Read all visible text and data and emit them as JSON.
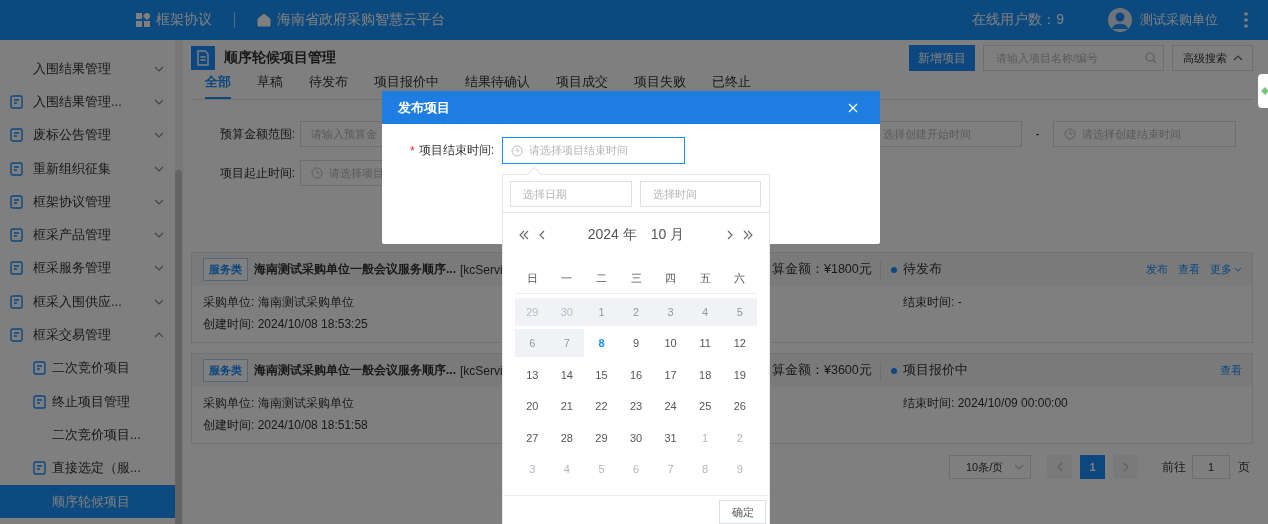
{
  "header": {
    "app_name": "框架协议",
    "platform": "海南省政府采购智慧云平台",
    "online_users": "在线用户数：9",
    "user": "测试采购单位"
  },
  "sidebar": {
    "items": [
      {
        "label": "入围结果管理",
        "kind": "plain",
        "expanded": false,
        "selected": false
      },
      {
        "label": "入围结果管理...",
        "kind": "iconed",
        "expanded": false,
        "selected": false
      },
      {
        "label": "废标公告管理",
        "kind": "iconed",
        "expanded": false,
        "selected": false
      },
      {
        "label": "重新组织征集",
        "kind": "iconed",
        "expanded": false,
        "selected": false
      },
      {
        "label": "框架协议管理",
        "kind": "iconed",
        "expanded": false,
        "selected": false
      },
      {
        "label": "框采产品管理",
        "kind": "iconed",
        "expanded": false,
        "selected": false
      },
      {
        "label": "框采服务管理",
        "kind": "iconed",
        "expanded": false,
        "selected": false
      },
      {
        "label": "框采入围供应...",
        "kind": "iconed",
        "expanded": false,
        "selected": false
      },
      {
        "label": "框采交易管理",
        "kind": "iconed",
        "expanded": true,
        "selected": false,
        "children": [
          {
            "label": "二次竞价项目",
            "kind": "iconed",
            "selected": false
          },
          {
            "label": "终止项目管理",
            "kind": "iconed",
            "selected": false
          },
          {
            "label": "二次竞价项目...",
            "kind": "plain",
            "selected": false
          },
          {
            "label": "直接选定（服...",
            "kind": "iconed",
            "selected": false
          },
          {
            "label": "顺序轮候项目",
            "kind": "plain",
            "selected": true
          }
        ]
      }
    ]
  },
  "page": {
    "title": "顺序轮候项目管理",
    "add_button": "新增项目",
    "search": {
      "placeholder": "请输入项目名称/编号"
    },
    "advanced_search": {
      "label": "高级搜索",
      "expanded": true
    }
  },
  "tabs": [
    {
      "label": "全部",
      "selected": true
    },
    {
      "label": "草稿",
      "selected": false
    },
    {
      "label": "待发布",
      "selected": false
    },
    {
      "label": "项目报价中",
      "selected": false
    },
    {
      "label": "结果待确认",
      "selected": false
    },
    {
      "label": "项目成交",
      "selected": false
    },
    {
      "label": "项目失败",
      "selected": false
    },
    {
      "label": "已终止",
      "selected": false
    }
  ],
  "filters": {
    "budget_label": "预算金额范围:",
    "budget_placeholder": "请输入预算金",
    "period_label": "项目起止时间:",
    "period_placeholder": "请选择项目",
    "created_start_placeholder": "选择创建开始时间",
    "separator": "-",
    "created_end_placeholder": "请选择创建结束时间"
  },
  "cards": [
    {
      "tag": "服务类",
      "title": "海南测试采购单位一般会议服务顺序...",
      "code": "[kcServi",
      "budget": "算金额：¥1800元",
      "status": "待发布",
      "actions": [
        {
          "label": "发布",
          "kind": "link"
        },
        {
          "label": "查看",
          "kind": "link"
        },
        {
          "label": "更多",
          "kind": "dropdown"
        }
      ],
      "buyer": "采购单位: 海南测试采购单位",
      "created": "创建时间: 2024/10/08 18:53:25",
      "end": "结束时间: -"
    },
    {
      "tag": "服务类",
      "title": "海南测试采购单位一般会议服务顺序...",
      "code": "[kcServi",
      "budget": "算金额：¥3600元",
      "status": "项目报价中",
      "actions": [
        {
          "label": "查看",
          "kind": "link"
        }
      ],
      "buyer": "采购单位: 海南测试采购单位",
      "created": "创建时间: 2024/10/08 18:51:58",
      "end": "结束时间: 2024/10/09 00:00:00"
    }
  ],
  "pagination": {
    "page_size": "10条/页",
    "pages": [
      {
        "label": "1",
        "selected": true
      }
    ],
    "goto_label": "前往",
    "goto_value": "1",
    "page_suffix": "页"
  },
  "dialog": {
    "title": "发布项目",
    "field_label": "项目结束时间:",
    "required_mark": "*",
    "placeholder": "请选择项目结束时间"
  },
  "date_picker": {
    "date_placeholder": "选择日期",
    "time_placeholder": "选择时间",
    "year": "2024 年",
    "month": "10 月",
    "weekdays": [
      "日",
      "一",
      "二",
      "三",
      "四",
      "五",
      "六"
    ],
    "weeks": [
      [
        {
          "day": "29",
          "outside": true,
          "disabled": true,
          "today": false
        },
        {
          "day": "30",
          "outside": true,
          "disabled": true,
          "today": false
        },
        {
          "day": "1",
          "outside": false,
          "disabled": true,
          "today": false
        },
        {
          "day": "2",
          "outside": false,
          "disabled": true,
          "today": false
        },
        {
          "day": "3",
          "outside": false,
          "disabled": true,
          "today": false
        },
        {
          "day": "4",
          "outside": false,
          "disabled": true,
          "today": false
        },
        {
          "day": "5",
          "outside": false,
          "disabled": true,
          "today": false
        }
      ],
      [
        {
          "day": "6",
          "outside": false,
          "disabled": true,
          "today": false
        },
        {
          "day": "7",
          "outside": false,
          "disabled": true,
          "today": false
        },
        {
          "day": "8",
          "outside": false,
          "disabled": false,
          "today": true
        },
        {
          "day": "9",
          "outside": false,
          "disabled": false,
          "today": false
        },
        {
          "day": "10",
          "outside": false,
          "disabled": false,
          "today": false
        },
        {
          "day": "11",
          "outside": false,
          "disabled": false,
          "today": false
        },
        {
          "day": "12",
          "outside": false,
          "disabled": false,
          "today": false
        }
      ],
      [
        {
          "day": "13",
          "outside": false,
          "disabled": false,
          "today": false
        },
        {
          "day": "14",
          "outside": false,
          "disabled": false,
          "today": false
        },
        {
          "day": "15",
          "outside": false,
          "disabled": false,
          "today": false
        },
        {
          "day": "16",
          "outside": false,
          "disabled": false,
          "today": false
        },
        {
          "day": "17",
          "outside": false,
          "disabled": false,
          "today": false
        },
        {
          "day": "18",
          "outside": false,
          "disabled": false,
          "today": false
        },
        {
          "day": "19",
          "outside": false,
          "disabled": false,
          "today": false
        }
      ],
      [
        {
          "day": "20",
          "outside": false,
          "disabled": false,
          "today": false
        },
        {
          "day": "21",
          "outside": false,
          "disabled": false,
          "today": false
        },
        {
          "day": "22",
          "outside": false,
          "disabled": false,
          "today": false
        },
        {
          "day": "23",
          "outside": false,
          "disabled": false,
          "today": false
        },
        {
          "day": "24",
          "outside": false,
          "disabled": false,
          "today": false
        },
        {
          "day": "25",
          "outside": false,
          "disabled": false,
          "today": false
        },
        {
          "day": "26",
          "outside": false,
          "disabled": false,
          "today": false
        }
      ],
      [
        {
          "day": "27",
          "outside": false,
          "disabled": false,
          "today": false
        },
        {
          "day": "28",
          "outside": false,
          "disabled": false,
          "today": false
        },
        {
          "day": "29",
          "outside": false,
          "disabled": false,
          "today": false
        },
        {
          "day": "30",
          "outside": false,
          "disabled": false,
          "today": false
        },
        {
          "day": "31",
          "outside": false,
          "disabled": false,
          "today": false
        },
        {
          "day": "1",
          "outside": true,
          "disabled": false,
          "today": false
        },
        {
          "day": "2",
          "outside": true,
          "disabled": false,
          "today": false
        }
      ],
      [
        {
          "day": "3",
          "outside": true,
          "disabled": false,
          "today": false
        },
        {
          "day": "4",
          "outside": true,
          "disabled": false,
          "today": false
        },
        {
          "day": "5",
          "outside": true,
          "disabled": false,
          "today": false
        },
        {
          "day": "6",
          "outside": true,
          "disabled": false,
          "today": false
        },
        {
          "day": "7",
          "outside": true,
          "disabled": false,
          "today": false
        },
        {
          "day": "8",
          "outside": true,
          "disabled": false,
          "today": false
        },
        {
          "day": "9",
          "outside": true,
          "disabled": false,
          "today": false
        }
      ]
    ],
    "confirm": "确定"
  }
}
